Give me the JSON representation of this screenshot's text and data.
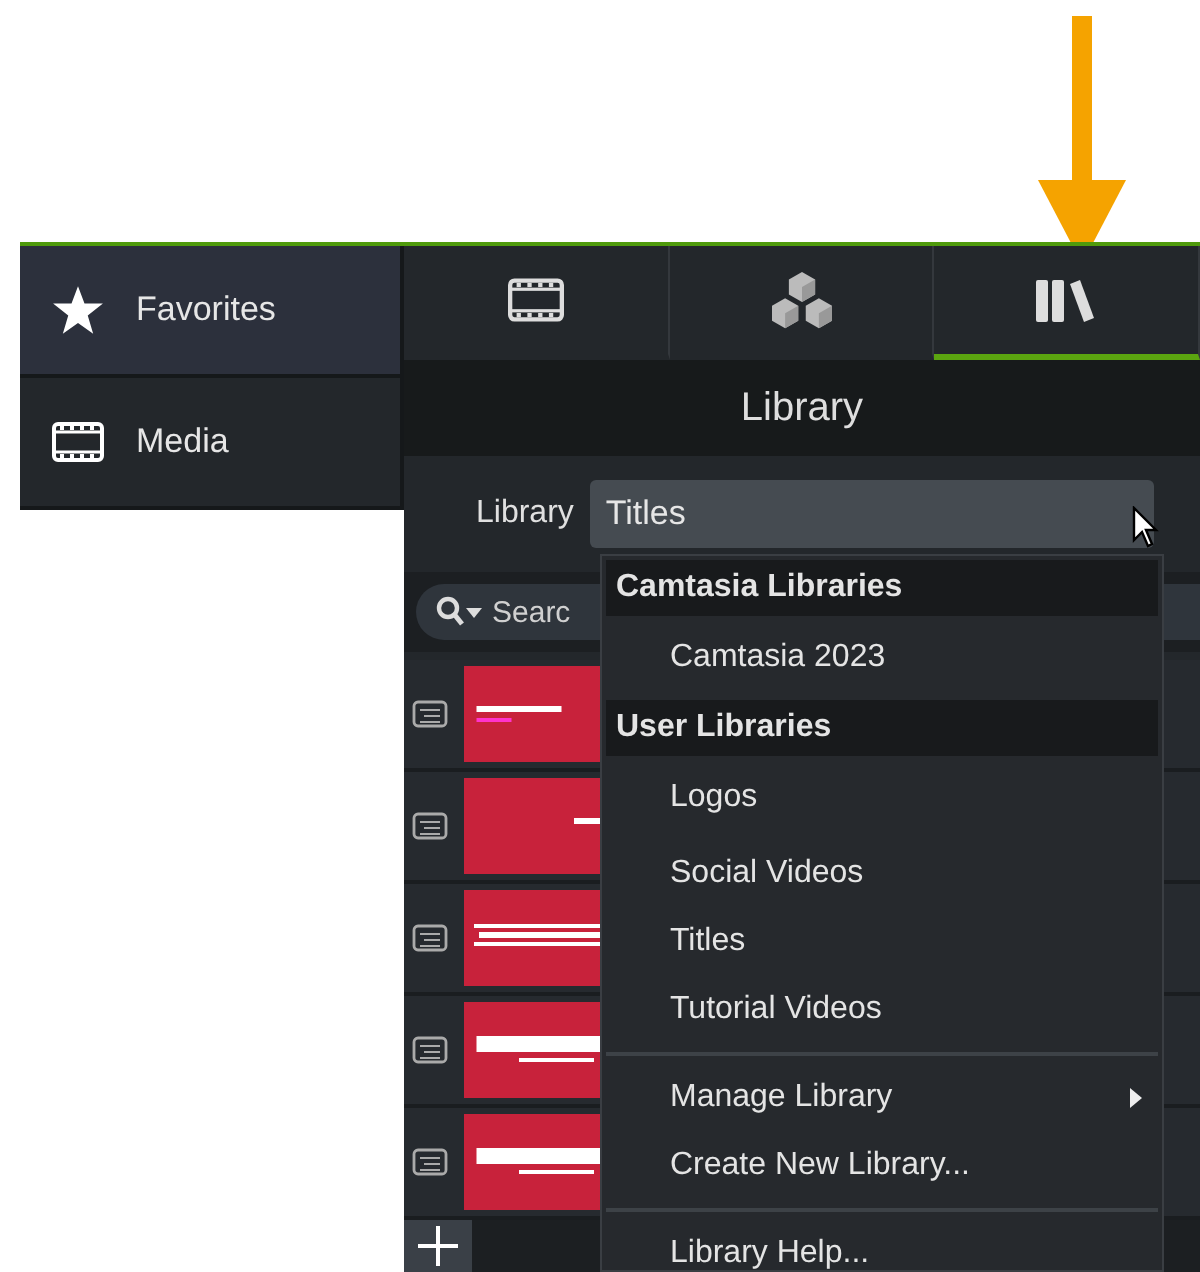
{
  "sidebar": {
    "items": [
      {
        "kind": "favorites",
        "label": "Favorites",
        "selected": true
      },
      {
        "kind": "media",
        "label": "Media",
        "selected": false
      }
    ]
  },
  "tabs": [
    {
      "kind": "media",
      "selected": false
    },
    {
      "kind": "annotations",
      "selected": false
    },
    {
      "kind": "library",
      "selected": true
    }
  ],
  "panel_title": "Library",
  "library_picker": {
    "label": "Library",
    "value": "Titles"
  },
  "search": {
    "placeholder": "Searc"
  },
  "menu": {
    "items": [
      {
        "kind": "header",
        "label": "Camtasia Libraries"
      },
      {
        "kind": "item",
        "label": "Camtasia 2023"
      },
      {
        "kind": "header",
        "label": "User Libraries"
      },
      {
        "kind": "item",
        "label": "Logos"
      },
      {
        "kind": "item",
        "label": "Social Videos"
      },
      {
        "kind": "item",
        "label": "Titles"
      },
      {
        "kind": "item",
        "label": "Tutorial Videos"
      },
      {
        "kind": "separator"
      },
      {
        "kind": "submenu",
        "label": "Manage Library"
      },
      {
        "kind": "item",
        "label": "Create New Library..."
      },
      {
        "kind": "separator"
      },
      {
        "kind": "item",
        "label": "Library Help..."
      }
    ]
  }
}
